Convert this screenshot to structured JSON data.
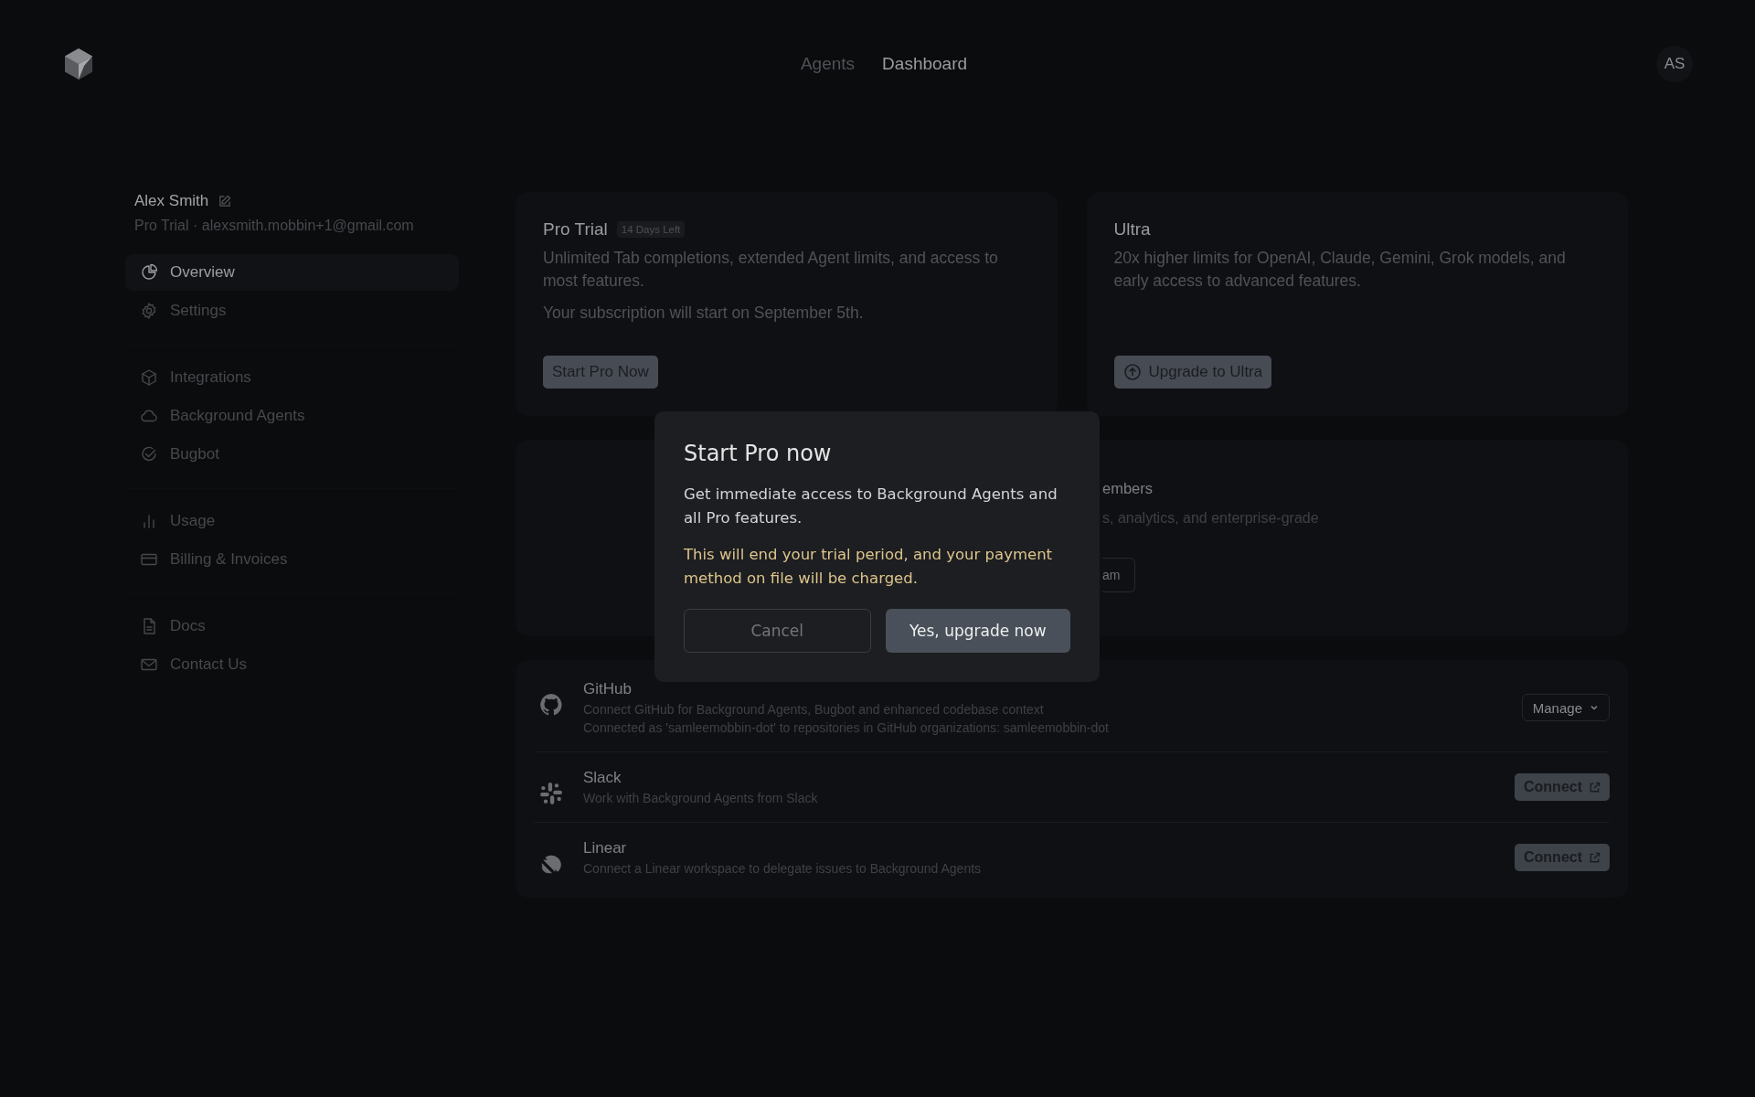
{
  "header": {
    "nav": [
      {
        "label": "Agents",
        "selected": false
      },
      {
        "label": "Dashboard",
        "selected": true
      }
    ],
    "avatar": "AS"
  },
  "profile": {
    "name": "Alex Smith",
    "plan_email": "Pro Trial · alexsmith.mobbin+1@gmail.com"
  },
  "sidebar": {
    "groups": [
      [
        {
          "label": "Overview",
          "selected": true
        },
        {
          "label": "Settings",
          "selected": false
        }
      ],
      [
        {
          "label": "Integrations",
          "selected": false
        },
        {
          "label": "Background Agents",
          "selected": false
        },
        {
          "label": "Bugbot",
          "selected": false
        }
      ],
      [
        {
          "label": "Usage",
          "selected": false
        },
        {
          "label": "Billing & Invoices",
          "selected": false
        }
      ],
      [
        {
          "label": "Docs",
          "selected": false
        },
        {
          "label": "Contact Us",
          "selected": false
        }
      ]
    ]
  },
  "plans": [
    {
      "title": "Pro Trial",
      "badge": "14 Days Left",
      "description": "Unlimited Tab completions, extended Agent limits, and access to most features.",
      "note": "Your subscription will start on September 5th.",
      "button": "Start Pro Now"
    },
    {
      "title": "Ultra",
      "description": "20x higher limits for OpenAI, Claude, Gemini, Grok models, and early access to advanced features.",
      "button": "Upgrade to Ultra"
    }
  ],
  "team_card": {
    "title": "embers",
    "description": "s, analytics, and enterprise-grade",
    "button": "am"
  },
  "integrations": [
    {
      "name": "GitHub",
      "description": "Connect GitHub for Background Agents, Bugbot and enhanced codebase context",
      "detail": "Connected as 'samleemobbin-dot' to repositories in GitHub organizations: samleemobbin-dot",
      "action": {
        "kind": "menu",
        "label": "Manage"
      }
    },
    {
      "name": "Slack",
      "description": "Work with Background Agents from Slack",
      "action": {
        "kind": "external",
        "label": "Connect"
      }
    },
    {
      "name": "Linear",
      "description": "Connect a Linear workspace to delegate issues to Background Agents",
      "action": {
        "kind": "external",
        "label": "Connect"
      }
    }
  ],
  "modal": {
    "title": "Start Pro now",
    "body": "Get immediate access to Background Agents and all Pro features.",
    "warning": "This will end your trial period, and your payment method on file will be charged.",
    "cancel": "Cancel",
    "confirm": "Yes, upgrade now"
  }
}
